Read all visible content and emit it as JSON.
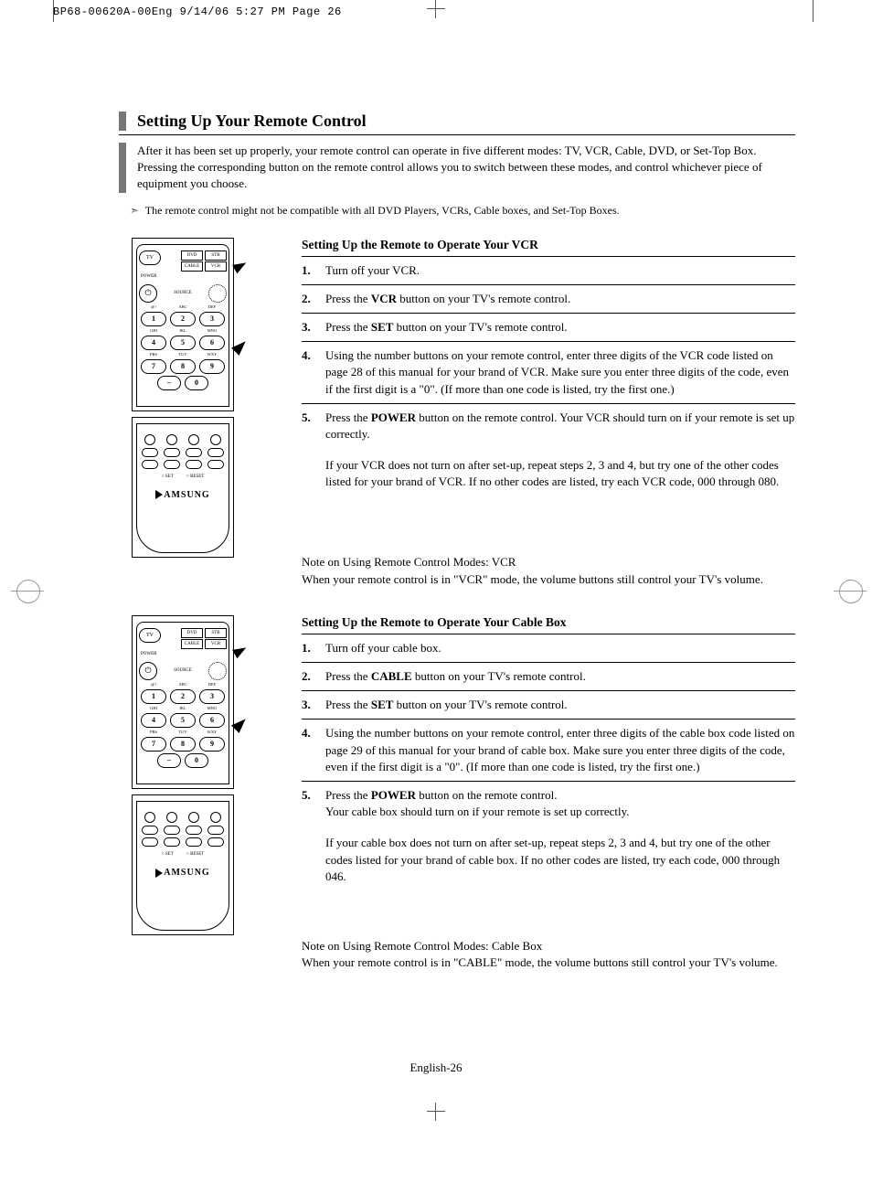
{
  "print_header": "BP68-00620A-00Eng  9/14/06  5:27 PM  Page 26",
  "page_number": "English-26",
  "section_title": "Setting Up Your Remote Control",
  "intro": "After it has been set up properly, your remote control can operate in five different modes: TV, VCR, Cable, DVD, or Set-Top Box. Pressing the corresponding button on the remote control allows you to switch between these modes, and control whichever piece of equipment you choose.",
  "compat_note": "The remote control might not be compatible with all DVD Players, VCRs, Cable boxes, and Set-Top Boxes.",
  "remote": {
    "tv": "TV",
    "dvd": "DVD",
    "stb": "STB",
    "cable": "CABLE",
    "vcr": "VCR",
    "power_label": "POWER",
    "source_label": "SOURCE",
    "num_labels": [
      "@!",
      "ABC",
      "DEF",
      "GHI",
      "JKL",
      "MNO",
      "PRS",
      "TUV",
      "WXY"
    ],
    "numbers": [
      "1",
      "2",
      "3",
      "4",
      "5",
      "6",
      "7",
      "8",
      "9"
    ],
    "dash": "–",
    "zero": "0",
    "brand": "AMSUNG",
    "set": "SET",
    "reset": "RESET"
  },
  "vcr": {
    "title": "Setting Up the Remote to Operate Your VCR",
    "steps": [
      {
        "n": "1.",
        "t": "Turn off your VCR."
      },
      {
        "n": "2.",
        "t": "Press the <b>VCR</b> button on your TV's remote control."
      },
      {
        "n": "3.",
        "t": "Press the <b>SET</b> button on your TV's remote control."
      },
      {
        "n": "4.",
        "t": "Using the number buttons on your remote control, enter three digits of the VCR code listed on page 28 of this manual for your brand of VCR. Make sure you enter three digits of the code, even if the first digit is a \"0\". (If more than one code is listed, try the first one.)"
      },
      {
        "n": "5.",
        "t": "Press the <b>POWER</b> button on the remote control. Your VCR should turn on if your remote is set up correctly."
      }
    ],
    "follow": "If your VCR does not turn on after set-up, repeat steps 2, 3 and 4, but try one of the other codes listed for your brand of VCR. If no other codes are listed, try each VCR code, 000 through 080.",
    "mode_note_1": "Note on Using Remote Control Modes: VCR",
    "mode_note_2": "When your remote control is in \"VCR\" mode, the volume buttons still control your TV's volume."
  },
  "cable": {
    "title": "Setting Up the Remote to Operate Your Cable Box",
    "steps": [
      {
        "n": "1.",
        "t": "Turn off your cable box."
      },
      {
        "n": "2.",
        "t": "Press the <b>CABLE</b> button on your TV's remote control."
      },
      {
        "n": "3.",
        "t": "Press the <b>SET</b> button on your TV's remote control."
      },
      {
        "n": "4.",
        "t": "Using the number buttons on your remote control, enter three digits of the cable box code listed on page 29 of this manual for your brand of cable box. Make sure you enter three digits of the code, even if the first digit is a \"0\". (If more than one code is listed, try the first one.)"
      },
      {
        "n": "5.",
        "t": "Press the <b>POWER</b> button on the remote control.<br>Your cable box should turn on if your remote is set up correctly."
      }
    ],
    "follow": "If your cable box does not turn on after set-up, repeat steps 2, 3 and 4, but try one of the other codes listed for your brand of cable box. If no other codes are listed, try each code, 000 through 046.",
    "mode_note_1": "Note on Using Remote Control Modes: Cable Box",
    "mode_note_2": "When your remote control is in \"CABLE\" mode, the volume buttons still control your TV's volume."
  }
}
